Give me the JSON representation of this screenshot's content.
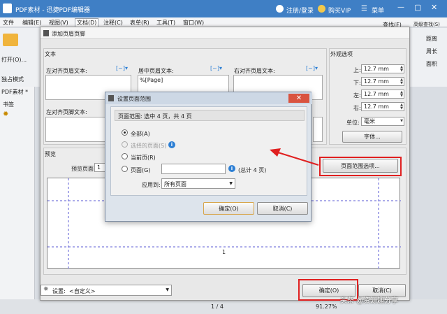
{
  "app": {
    "title": "PDF素材 - 迅捷PDF编辑器",
    "login": "注册/登录",
    "vip": "购买VIP",
    "menu_label": "菜单"
  },
  "menubar": [
    "文件",
    "编辑(E)",
    "视图(V)",
    "文档(D)",
    "注释(C)",
    "表单(R)",
    "工具(T)",
    "窗口(W)"
  ],
  "ribbon": {
    "open_label": "打开(O)...",
    "standalone_label": "独占模式",
    "find": "查找(F)",
    "advanced_find": "高级查找(S)",
    "distance": "距离",
    "perimeter": "周长",
    "area": "面积"
  },
  "sidebar": {
    "doc_tab": "PDF素材 *",
    "bookmarks": "书签"
  },
  "dialog": {
    "title": "添加页眉页脚",
    "text_group": "文本",
    "left_header": "左对齐页眉文本:",
    "center_header": "居中页眉文本:",
    "right_header": "右对齐页眉文本:",
    "center_header_value": "%[Page]",
    "left_footer": "左对齐页脚文本:",
    "appearance_group": "外观选项",
    "margin_top_label": "上:",
    "margin_bottom_label": "下:",
    "margin_left_label": "左:",
    "margin_right_label": "右:",
    "margin_top": "12.7 mm",
    "margin_bottom": "12.7 mm",
    "margin_left": "12.7 mm",
    "margin_right": "12.7 mm",
    "unit_label": "单位:",
    "unit_value": "毫米",
    "font_button": "字体...",
    "page_range_button": "页面范围选项...",
    "preview_group": "预览",
    "preview_page_label": "预览页面",
    "preview_page_value": "1",
    "preview_page_number": "1",
    "settings_label": "设置:",
    "settings_value": "<自定义>",
    "ok": "确定(O)",
    "cancel": "取消(C)"
  },
  "modal": {
    "title": "设置页面范围",
    "range_info": "页面范围: 选中 4 页，共 4 页",
    "opt_all": "全部(A)",
    "opt_selected": "选择的页面(S)",
    "opt_current": "当前页(R)",
    "opt_pages": "页面(G)",
    "total_pages": "(总计 4 页)",
    "apply_label": "应用到:",
    "apply_value": "所有页面",
    "ok": "确定(O)",
    "cancel": "取消(C)"
  },
  "status": {
    "page_display": "1 / 4",
    "zoom": "91.27%"
  },
  "watermark": "头条 @资源趣分享",
  "colors": {
    "titlebar": "#3f7fc5",
    "highlight_red": "#e02020",
    "info_blue": "#2d7fd4"
  }
}
